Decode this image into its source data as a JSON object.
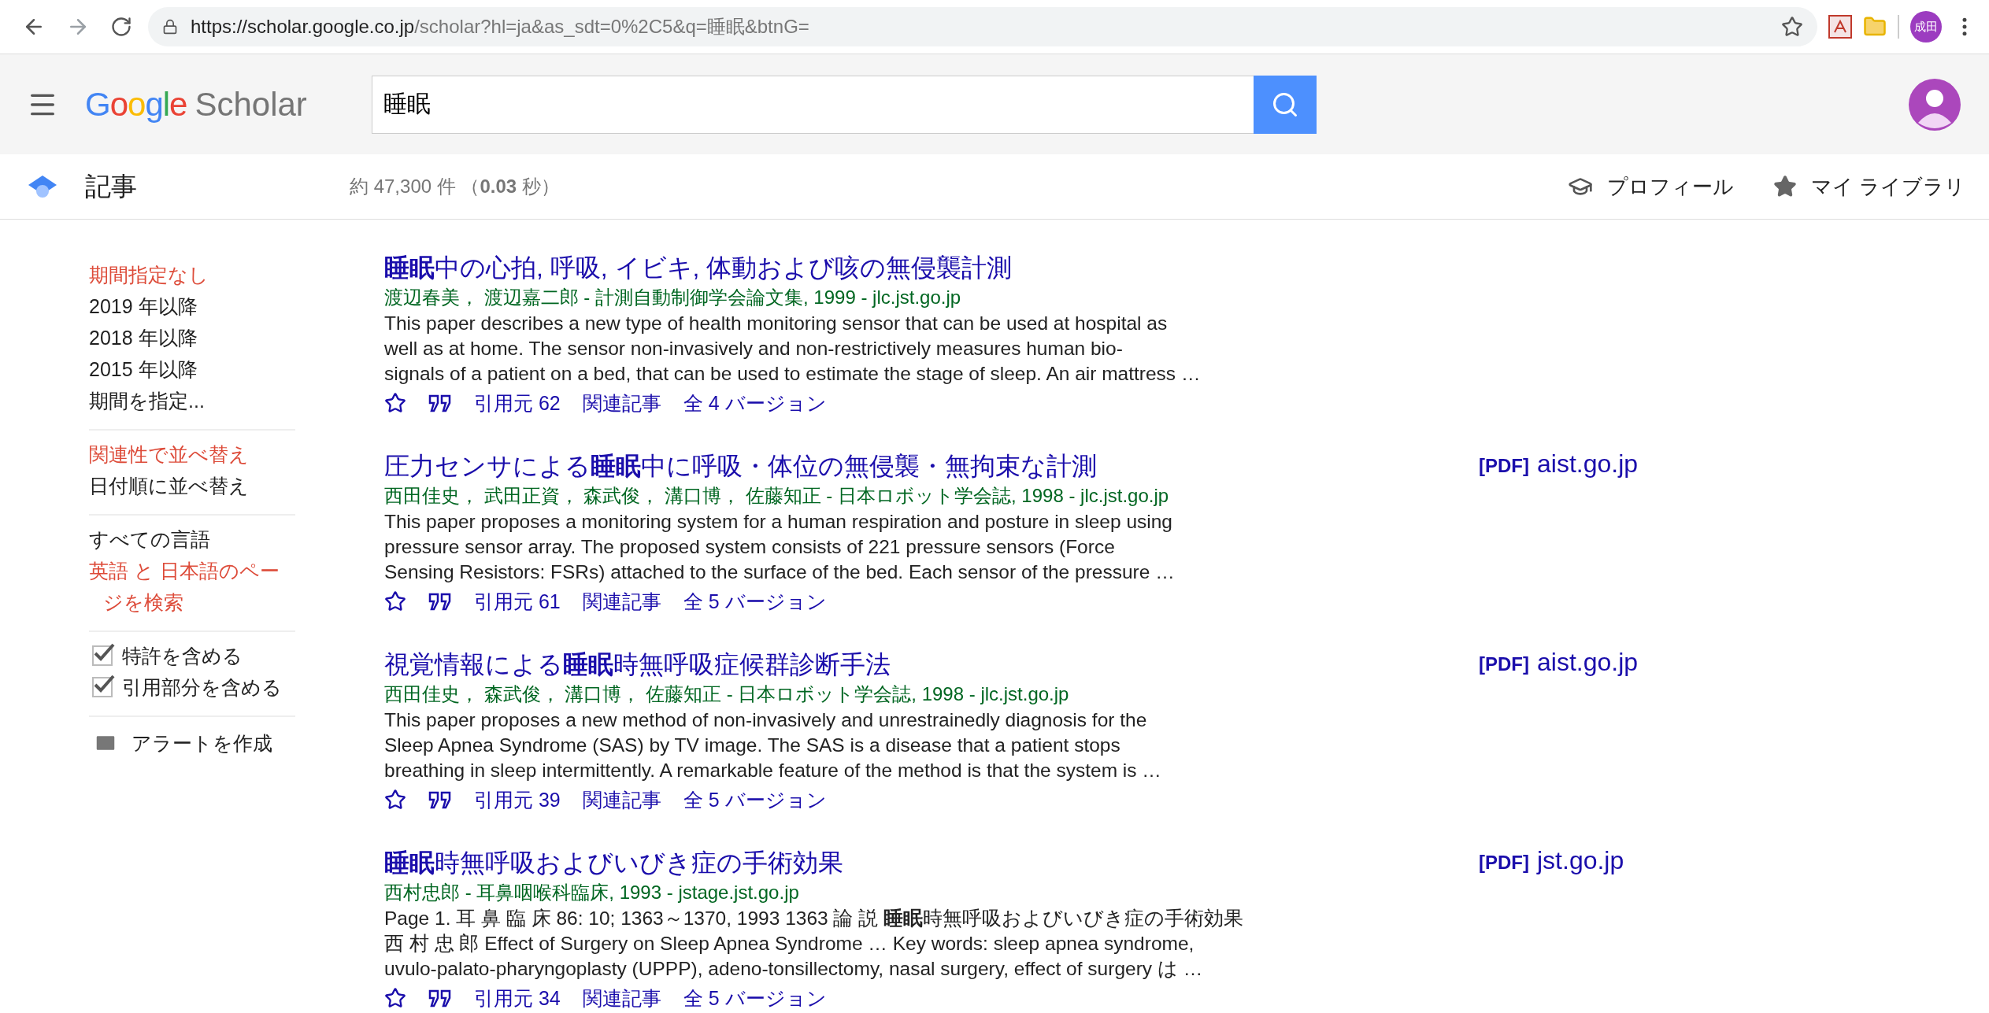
{
  "browser": {
    "url_host": "https://scholar.google.co.jp",
    "url_path": "/scholar?hl=ja&as_sdt=0%2C5&q=睡眠&btnG=",
    "profile_badge": "成田"
  },
  "header": {
    "logo_brand": "Google",
    "logo_product": "Scholar",
    "search": {
      "value": "睡眠"
    }
  },
  "nav": {
    "section": "記事",
    "result_count": "約 47,300 件 （**0.03** 秒）",
    "links": [
      {
        "kind": "profile",
        "label": "プロフィール"
      },
      {
        "kind": "library",
        "label": "マイ ライブラリ"
      }
    ]
  },
  "sidebar": {
    "groups": [
      {
        "kind": "links",
        "items": [
          {
            "label": "期間指定なし",
            "selected": true
          },
          {
            "label": "2019 年以降",
            "selected": false
          },
          {
            "label": "2018 年以降",
            "selected": false
          },
          {
            "label": "2015 年以降",
            "selected": false
          },
          {
            "label": "期間を指定...",
            "selected": false
          }
        ]
      },
      {
        "kind": "links",
        "items": [
          {
            "label": "関連性で並べ替え",
            "selected": true
          },
          {
            "label": "日付順に並べ替え",
            "selected": false
          }
        ]
      },
      {
        "kind": "links",
        "items": [
          {
            "label": "すべての言語",
            "selected": false
          },
          {
            "label": "英語 と 日本語のページを検索",
            "selected": true
          }
        ]
      },
      {
        "kind": "checks",
        "items": [
          {
            "label": "特許を含める",
            "checked": true
          },
          {
            "label": "引用部分を含める",
            "checked": true
          }
        ]
      },
      {
        "kind": "alert",
        "items": [
          {
            "label": "アラートを作成"
          }
        ]
      }
    ]
  },
  "results": [
    {
      "title": "**睡眠**中の心拍, 呼吸, イビキ, 体動および咳の無侵襲計測",
      "authors": "渡辺春美， 渡辺嘉二郎 - 計測自動制御学会論文集, 1999 - jlc.jst.go.jp",
      "snippet_lines": [
        "This paper describes a new type of health monitoring sensor that can be used at hospital as",
        "well as at home. The sensor non-invasively and non-restrictively measures human bio-",
        "signals of a patient on a bed, that can be used to estimate the stage of sleep. An air mattress …"
      ],
      "cited": "引用元 62",
      "related": "関連記事",
      "versions": "全 4 バージョン"
    },
    {
      "title": "圧力センサによる**睡眠**中に呼吸・体位の無侵襲・無拘束な計測",
      "authors": "西田佳史， 武田正資， 森武俊， 溝口博， 佐藤知正 - 日本ロボット学会誌, 1998 - jlc.jst.go.jp",
      "snippet_lines": [
        "This paper proposes a monitoring system for a human respiration and posture in sleep using",
        "pressure sensor array. The proposed system consists of 221 pressure sensors (Force",
        "Sensing Resistors: FSRs) attached to the surface of the bed. Each sensor of the pressure …"
      ],
      "cited": "引用元 61",
      "related": "関連記事",
      "versions": "全 5 バージョン",
      "pdf": {
        "tag": "[PDF]",
        "domain": "aist.go.jp"
      }
    },
    {
      "title": "視覚情報による**睡眠**時無呼吸症候群診断手法",
      "authors": "西田佳史， 森武俊， 溝口博， 佐藤知正 - 日本ロボット学会誌, 1998 - jlc.jst.go.jp",
      "snippet_lines": [
        "This paper proposes a new method of non-invasively and unrestrainedly diagnosis for the",
        "Sleep Apnea Syndrome (SAS) by TV image. The SAS is a disease that a patient stops",
        "breathing in sleep intermittently. A remarkable feature of the method is that the system is …"
      ],
      "cited": "引用元 39",
      "related": "関連記事",
      "versions": "全 5 バージョン",
      "pdf": {
        "tag": "[PDF]",
        "domain": "aist.go.jp"
      }
    },
    {
      "title": "**睡眠**時無呼吸およびいびき症の手術効果",
      "authors": "西村忠郎 - 耳鼻咽喉科臨床, 1993 - jstage.jst.go.jp",
      "snippet_lines": [
        "Page 1. 耳 鼻 臨 床 86: 10; 1363～1370, 1993 1363 論 説 **睡眠**時無呼吸およびいびき症の手術効果",
        "西 村 忠 郎 Effect of Surgery on Sleep Apnea Syndrome … Key words: sleep apnea syndrome,",
        "uvulo-palato-pharyngoplasty (UPPP), adeno-tonsillectomy, nasal surgery, effect of surgery は …"
      ],
      "cited": "引用元 34",
      "related": "関連記事",
      "versions": "全 5 バージョン",
      "pdf": {
        "tag": "[PDF]",
        "domain": "jst.go.jp"
      }
    }
  ]
}
